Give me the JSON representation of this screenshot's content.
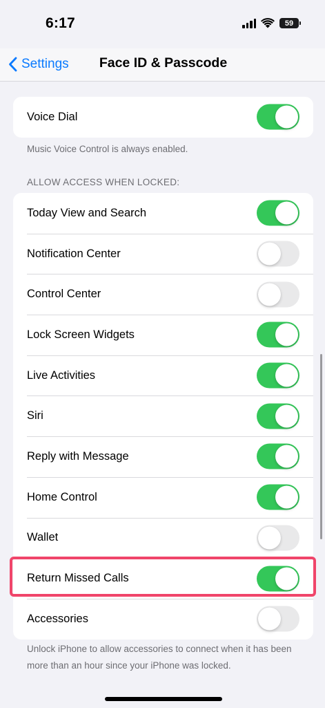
{
  "status_bar": {
    "time": "6:17",
    "battery_level": "59",
    "icons": [
      "cellular-signal-icon",
      "wifi-icon",
      "battery-icon"
    ]
  },
  "nav": {
    "back_label": "Settings",
    "title": "Face ID & Passcode"
  },
  "voice_dial": {
    "label": "Voice Dial",
    "on": true,
    "footnote": "Music Voice Control is always enabled."
  },
  "locked_access": {
    "header": "ALLOW ACCESS WHEN LOCKED:",
    "items": [
      {
        "label": "Today View and Search",
        "on": true
      },
      {
        "label": "Notification Center",
        "on": false
      },
      {
        "label": "Control Center",
        "on": false
      },
      {
        "label": "Lock Screen Widgets",
        "on": true
      },
      {
        "label": "Live Activities",
        "on": true
      },
      {
        "label": "Siri",
        "on": true
      },
      {
        "label": "Reply with Message",
        "on": true
      },
      {
        "label": "Home Control",
        "on": true
      },
      {
        "label": "Wallet",
        "on": false
      },
      {
        "label": "Return Missed Calls",
        "on": true
      },
      {
        "label": "Accessories",
        "on": false
      }
    ],
    "footnote": "Unlock iPhone to allow accessories to connect when it has been more than an hour since your iPhone was locked."
  },
  "colors": {
    "toggle_on": "#34c759",
    "toggle_off": "#e9e9ea",
    "accent": "#0a7aff",
    "highlight": "#f0456a"
  }
}
